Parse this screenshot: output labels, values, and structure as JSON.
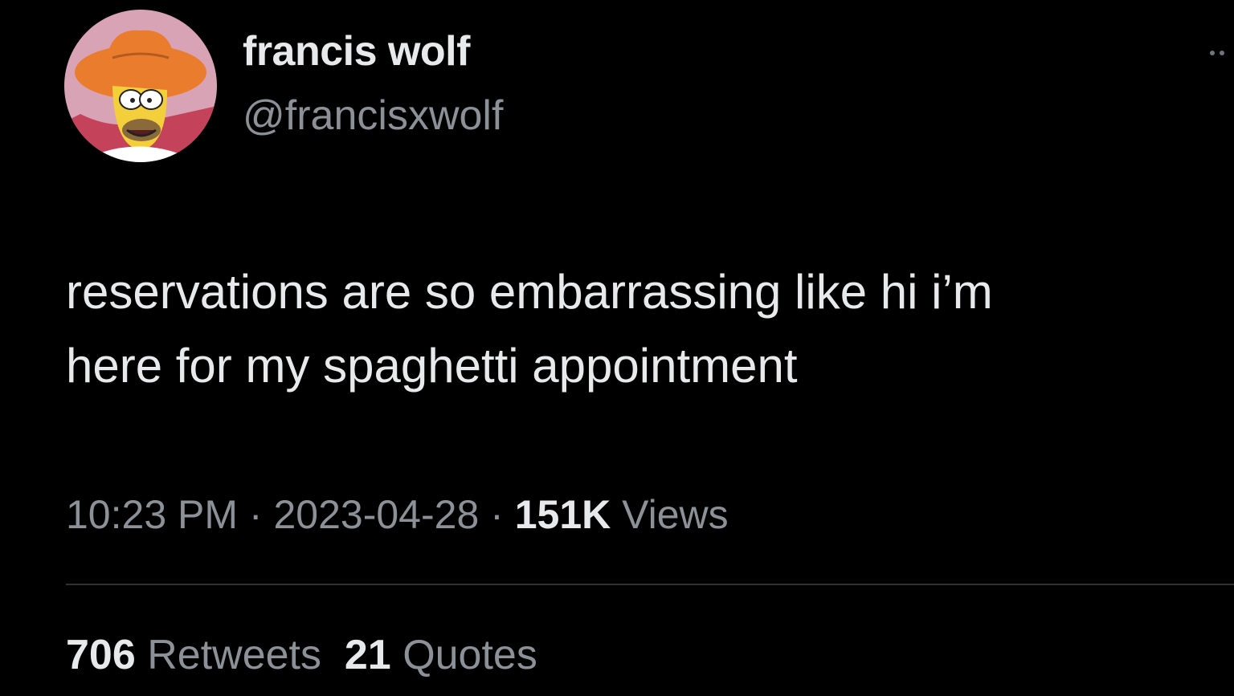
{
  "author": {
    "display_name": "francis wolf",
    "handle": "@francisxwolf",
    "avatar_icon": "cartoon-cowboy-avatar-icon"
  },
  "tweet": {
    "text_lines": [
      "reservations are so embarrassing like hi i’m",
      "here for my spaghetti appointment"
    ]
  },
  "meta": {
    "time": "10:23 PM",
    "separator": "·",
    "date": "2023-04-28",
    "views_count": "151K",
    "views_label": "Views"
  },
  "stats": {
    "retweets_count": "706",
    "retweets_label": "Retweets",
    "quotes_count": "21",
    "quotes_label": "Quotes"
  },
  "colors": {
    "background": "#000000",
    "primary_text": "#e7e9ea",
    "secondary_text": "#8b9197",
    "divider": "#2f3336"
  }
}
